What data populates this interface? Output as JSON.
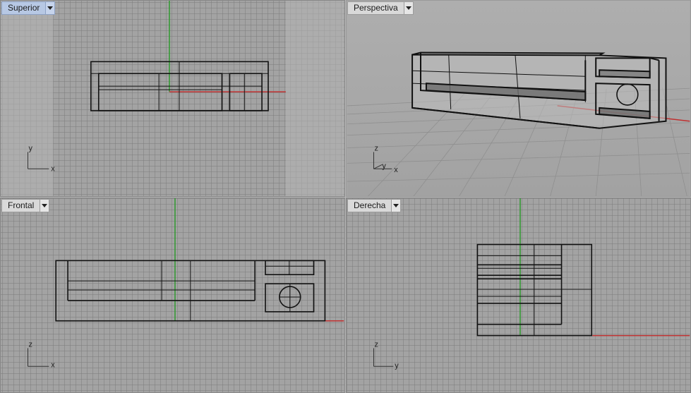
{
  "viewports": {
    "top": {
      "label": "Superior",
      "axis_h": "x",
      "axis_v": "y",
      "active": true
    },
    "perspective": {
      "label": "Perspectiva",
      "axis_h": "x",
      "axis_d": "y",
      "axis_v": "z",
      "active": false
    },
    "front": {
      "label": "Frontal",
      "axis_h": "x",
      "axis_v": "z",
      "active": false
    },
    "right": {
      "label": "Derecha",
      "axis_h": "y",
      "axis_v": "z",
      "active": false
    }
  },
  "icons": {
    "dropdown": "chevron-down-icon",
    "axis_triad": "axis-triad-icon"
  },
  "colors": {
    "x_axis": "#c03030",
    "y_axis": "#2f9a2f",
    "wire": "#111111",
    "tab_active": "#b7c8e4",
    "tab_inactive": "#d9d9d9"
  }
}
